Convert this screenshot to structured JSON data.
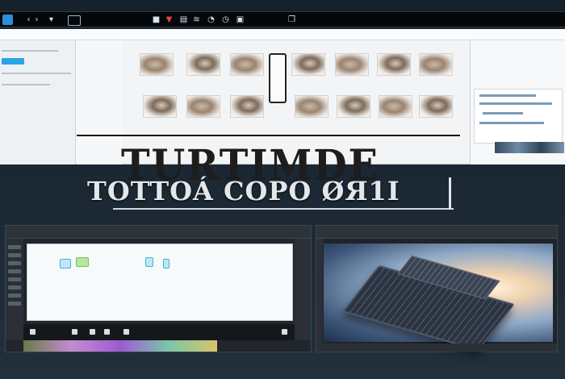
{
  "colors": {
    "accent": "#29a5e3",
    "toolbar_bg": "#05080b",
    "background": "#1b2733"
  },
  "toolbar": {
    "icons": [
      "app-icon",
      "back-icon",
      "forward-icon",
      "dropdown-icon",
      "field",
      "record-icon",
      "chevron-icon",
      "film-icon",
      "speed-icon",
      "gauge-icon",
      "timer-icon",
      "photo-icon",
      "window-icon"
    ]
  },
  "editor": {
    "menu": [
      "",
      "",
      "",
      "",
      "",
      "",
      "",
      ""
    ]
  },
  "headline": {
    "title": "TURTIMDE",
    "subtitle": "TOTTOÁ COPO ØЯ1I"
  }
}
